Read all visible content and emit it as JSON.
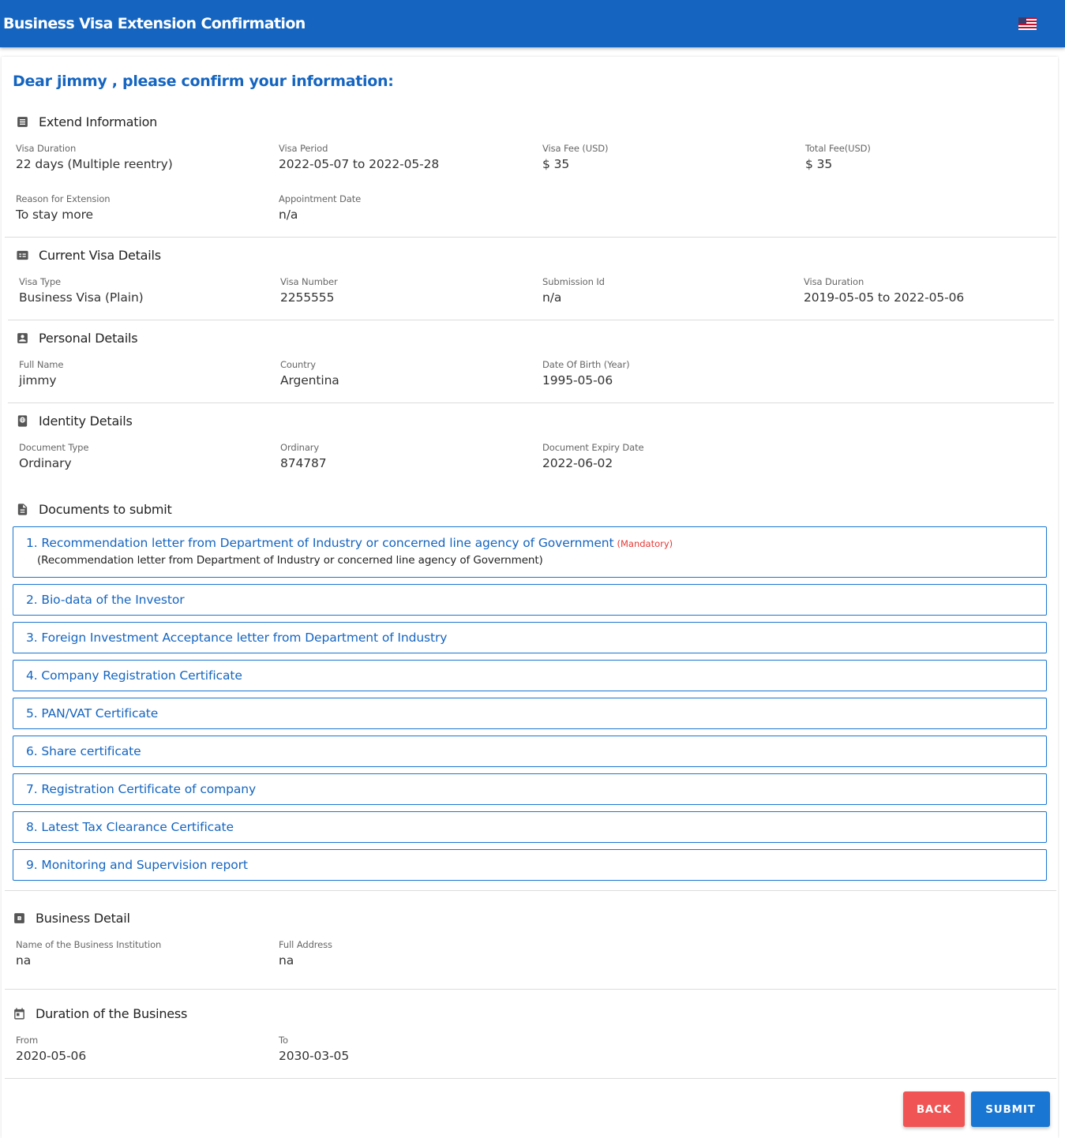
{
  "header": {
    "title": "Business Visa Extension Confirmation",
    "language_flag": "us-flag-icon"
  },
  "greeting": "Dear jimmy , please confirm your information:",
  "extend_info": {
    "title": "Extend Information",
    "icon": "list-box-icon",
    "visa_duration": {
      "label": "Visa Duration",
      "value": "22 days (Multiple reentry)"
    },
    "visa_period": {
      "label": "Visa Period",
      "value": "2022-05-07 to 2022-05-28"
    },
    "visa_fee": {
      "label": "Visa Fee (USD)",
      "value": "$ 35"
    },
    "total_fee": {
      "label": "Total Fee(USD)",
      "value": "$ 35"
    },
    "reason": {
      "label": "Reason for Extension",
      "value": "To stay more"
    },
    "appointment": {
      "label": "Appointment Date",
      "value": "n/a"
    }
  },
  "current_visa": {
    "title": "Current Visa Details",
    "icon": "card-details-icon",
    "visa_type": {
      "label": "Visa Type",
      "value": "Business Visa (Plain)"
    },
    "visa_number": {
      "label": "Visa Number",
      "value": "2255555"
    },
    "submission_id": {
      "label": "Submission Id",
      "value": "n/a"
    },
    "visa_duration": {
      "label": "Visa Duration",
      "value": "2019-05-05 to 2022-05-06"
    }
  },
  "personal": {
    "title": "Personal Details",
    "icon": "account-box-icon",
    "full_name": {
      "label": "Full Name",
      "value": "jimmy"
    },
    "country": {
      "label": "Country",
      "value": "Argentina"
    },
    "dob": {
      "label": "Date Of Birth (Year)",
      "value": "1995-05-06"
    }
  },
  "identity": {
    "title": "Identity Details",
    "icon": "passport-icon",
    "doc_type": {
      "label": "Document Type",
      "value": "Ordinary"
    },
    "ordinary": {
      "label": "Ordinary",
      "value": "874787"
    },
    "expiry": {
      "label": "Document Expiry Date",
      "value": "2022-06-02"
    }
  },
  "documents": {
    "title": "Documents to submit",
    "icon": "file-document-icon",
    "mandatory_tag": "(Mandatory)",
    "items": [
      {
        "label": "1. Recommendation letter from Department of Industry or concerned line agency of Government",
        "sub": "(Recommendation letter from Department of Industry or concerned line agency of Government)"
      },
      {
        "label": "2. Bio-data of the Investor"
      },
      {
        "label": "3. Foreign Investment Acceptance letter from Department of Industry"
      },
      {
        "label": "4. Company Registration Certificate"
      },
      {
        "label": "5. PAN/VAT Certificate"
      },
      {
        "label": "6. Share certificate"
      },
      {
        "label": "7. Registration Certificate of company"
      },
      {
        "label": "8. Latest Tax Clearance Certificate"
      },
      {
        "label": "9. Monitoring and Supervision report"
      }
    ]
  },
  "business": {
    "title": "Business Detail",
    "icon": "letter-b-box-icon",
    "name": {
      "label": "Name of the Business Institution",
      "value": "na"
    },
    "address": {
      "label": "Full Address",
      "value": "na"
    }
  },
  "duration": {
    "title": "Duration of the Business",
    "icon": "calendar-icon",
    "from": {
      "label": "From",
      "value": "2020-05-06"
    },
    "to": {
      "label": "To",
      "value": "2030-03-05"
    }
  },
  "actions": {
    "back": "BACK",
    "submit": "SUBMIT"
  },
  "colors": {
    "primary": "#1565c0",
    "back_button": "#f05454",
    "submit_button": "#1976d2",
    "mandatory": "#e53935"
  }
}
